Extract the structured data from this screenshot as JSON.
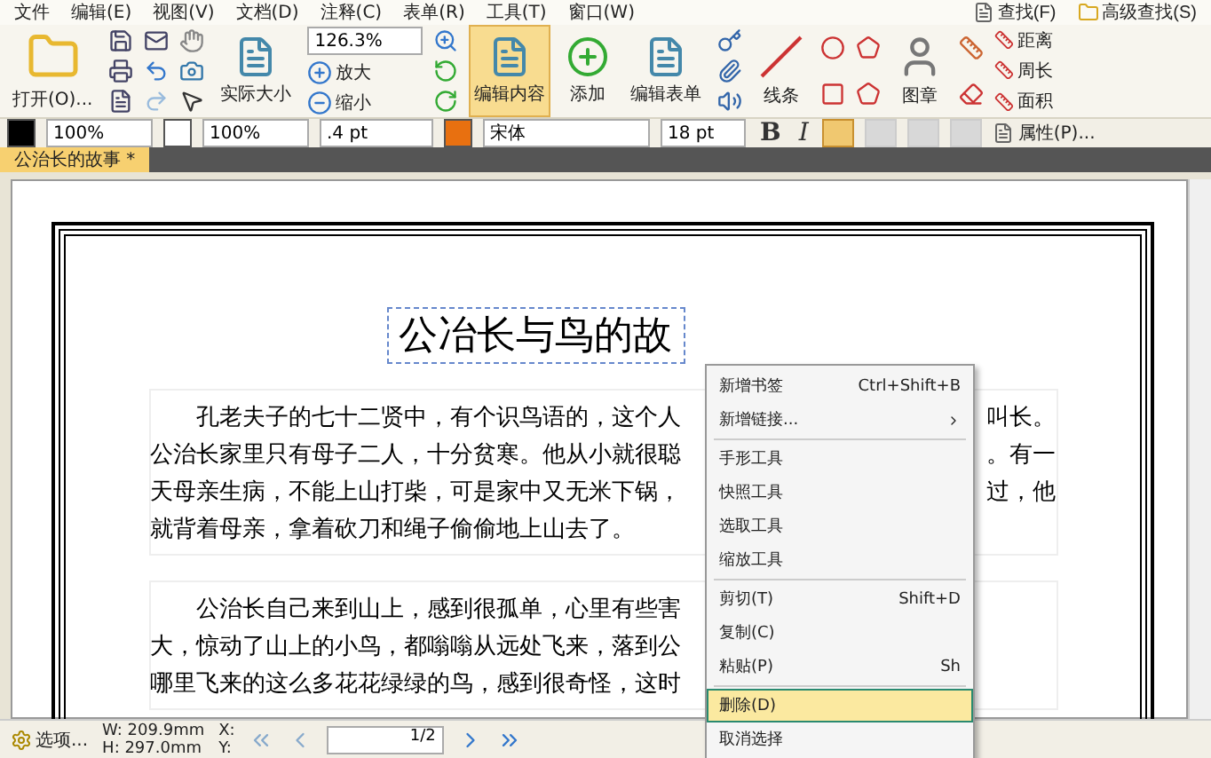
{
  "menu_bar": {
    "items": [
      "文件",
      "编辑(E)",
      "视图(V)",
      "文档(D)",
      "注释(C)",
      "表单(R)",
      "工具(T)",
      "窗口(W)"
    ],
    "search": [
      {
        "label": "查找(F)"
      },
      {
        "label": "高级查找(S)"
      }
    ]
  },
  "ribbon": {
    "open": "打开(O)...",
    "actual_size": "实际大小",
    "zoom": "126.3%",
    "zoom_in": "放大",
    "zoom_out": "缩小",
    "big_buttons": [
      {
        "label": "编辑内容",
        "selected": true
      },
      {
        "label": "添加",
        "selected": false
      },
      {
        "label": "编辑表单",
        "selected": false
      }
    ],
    "line": "线条",
    "stamp": "图章",
    "measure": [
      "距离",
      "周长",
      "面积"
    ]
  },
  "format_bar": {
    "fill_opacity": "100%",
    "stroke_opacity": "100%",
    "stroke_width": ".4 pt",
    "font": "宋体",
    "font_size": "18 pt",
    "bold": "B",
    "italic": "I",
    "alignments": [
      {
        "selected": true
      },
      {
        "selected": false
      },
      {
        "selected": false
      },
      {
        "selected": false
      }
    ],
    "properties": "属性(P)..."
  },
  "tabs": [
    {
      "label": "公治长的故事 *",
      "selected": true
    }
  ],
  "document": {
    "title": "公冶长与鸟的故",
    "paragraphs": [
      [
        {
          "left": "孔老夫子的七十二贤中，有个识鸟语的，这个人",
          "right": "叫长。"
        },
        {
          "left": "公治长家里只有母子二人，十分贫寒。他从小就很聪",
          "right": "。有一"
        },
        {
          "left": "天母亲生病，不能上山打柴，可是家中又无米下锅，",
          "right": "过，他"
        },
        {
          "left": "就背着母亲，拿着砍刀和绳子偷偷地上山去了。"
        }
      ],
      [
        {
          "left": "公治长自己来到山上，感到很孤单，心里有些害"
        },
        {
          "left": "大，惊动了山上的小鸟，都嗡嗡从远处飞来，落到公"
        },
        {
          "left": "哪里飞来的这么多花花绿绿的鸟，感到很奇怪，这时"
        }
      ]
    ]
  },
  "context_menu": [
    {
      "kind": "item",
      "label": "新增书签",
      "shortcut": "Ctrl+Shift+B",
      "submenu": false,
      "selected": false
    },
    {
      "kind": "item",
      "label": "新增链接...",
      "submenu": true,
      "selected": false
    },
    {
      "kind": "separator"
    },
    {
      "kind": "item",
      "label": "手形工具",
      "submenu": false,
      "selected": false
    },
    {
      "kind": "item",
      "label": "快照工具",
      "submenu": false,
      "selected": false
    },
    {
      "kind": "item",
      "label": "选取工具",
      "submenu": false,
      "selected": false
    },
    {
      "kind": "item",
      "label": "缩放工具",
      "submenu": false,
      "selected": false
    },
    {
      "kind": "separator"
    },
    {
      "kind": "item",
      "label": "剪切(T)",
      "shortcut": "Shift+D",
      "submenu": false,
      "selected": false
    },
    {
      "kind": "item",
      "label": "复制(C)",
      "submenu": false,
      "selected": false
    },
    {
      "kind": "item",
      "label": "粘贴(P)",
      "shortcut": "Sh",
      "submenu": false,
      "selected": false
    },
    {
      "kind": "separator"
    },
    {
      "kind": "item",
      "label": "删除(D)",
      "submenu": false,
      "selected": true
    },
    {
      "kind": "item",
      "label": "取消选择",
      "submenu": false,
      "selected": false
    }
  ],
  "status_bar": {
    "options": "选项...",
    "width": "W: 209.9mm",
    "height": "H: 297.0mm",
    "x": "X:",
    "y": "Y:",
    "page": "1/2"
  }
}
